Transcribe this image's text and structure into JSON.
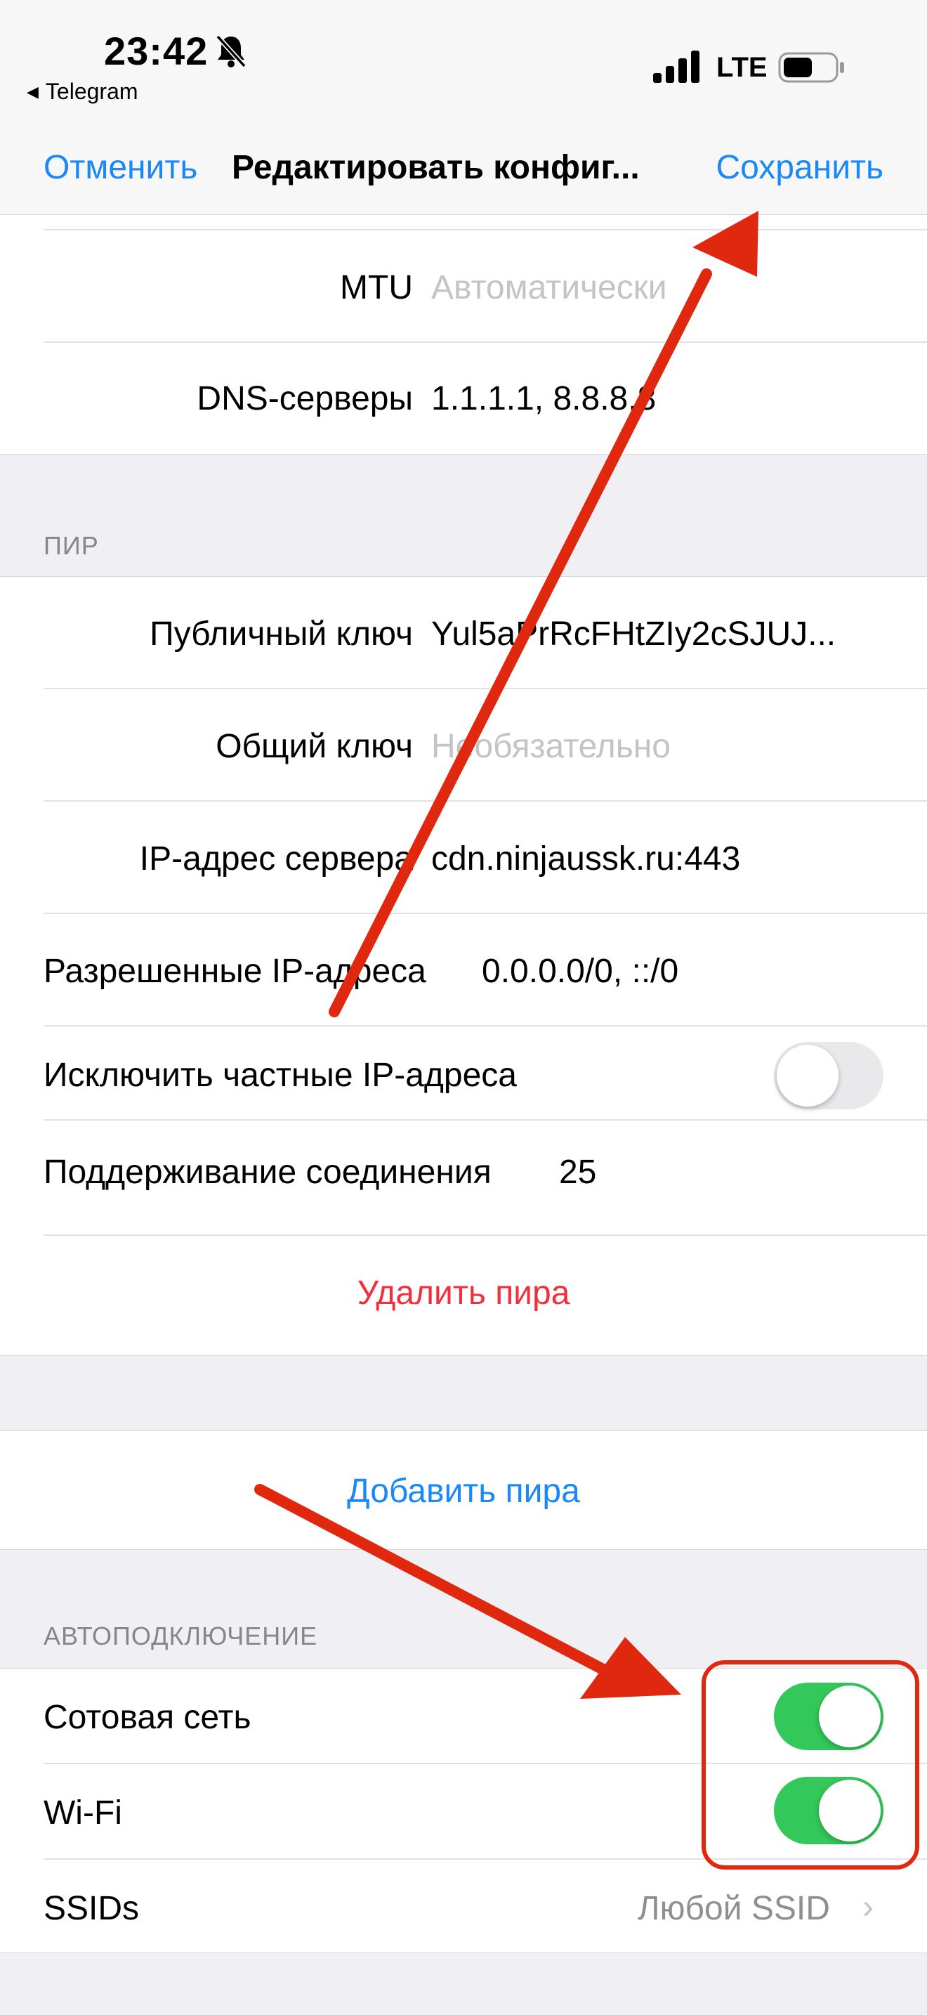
{
  "status_bar": {
    "time": "23:42",
    "back_app": "Telegram",
    "network": "LTE",
    "icons": [
      "bell-slash-icon",
      "signal-icon",
      "battery-icon"
    ]
  },
  "nav": {
    "cancel": "Отменить",
    "title": "Редактировать конфиг...",
    "save": "Сохранить"
  },
  "interface": {
    "mtu_label": "MTU",
    "mtu_placeholder": "Автоматически",
    "dns_label": "DNS-серверы",
    "dns_value": "1.1.1.1, 8.8.8.8"
  },
  "peer": {
    "header": "ПИР",
    "public_key_label": "Публичный ключ",
    "public_key_value": "Yul5aPrRcFHtZIy2cSJUJ...",
    "preshared_key_label": "Общий ключ",
    "preshared_key_placeholder": "Необязательно",
    "endpoint_label": "IP-адрес сервера",
    "endpoint_value": "cdn.ninjaussk.ru:443",
    "allowed_ips_label": "Разрешенные IP-адреса",
    "allowed_ips_value": "0.0.0.0/0, ::/0",
    "exclude_private_label": "Исключить частные IP-адреса",
    "exclude_private_on": false,
    "keepalive_label": "Поддерживание соединения",
    "keepalive_value": "25",
    "delete_peer": "Удалить пира"
  },
  "add_peer": "Добавить пира",
  "on_demand": {
    "header": "АВТОПОДКЛЮЧЕНИЕ",
    "cellular_label": "Сотовая сеть",
    "cellular_on": true,
    "wifi_label": "Wi-Fi",
    "wifi_on": true,
    "ssids_label": "SSIDs",
    "ssids_value": "Любой SSID"
  },
  "colors": {
    "accent_blue": "#1a88f7",
    "destructive_red": "#f0303c",
    "toggle_on_green": "#34c759",
    "annotation_red": "#e0280f"
  }
}
